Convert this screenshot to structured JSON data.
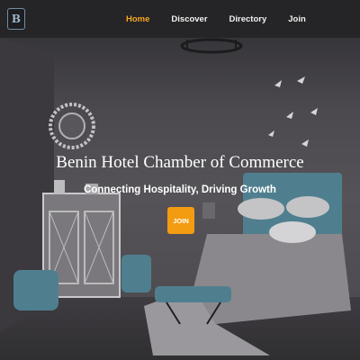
{
  "brand": {
    "logo_letter": "B"
  },
  "nav": {
    "items": [
      {
        "label": "Home",
        "active": true
      },
      {
        "label": "Discover",
        "active": false
      },
      {
        "label": "Directory",
        "active": false
      },
      {
        "label": "Join",
        "active": false
      }
    ]
  },
  "hero": {
    "title": "Benin Hotel Chamber of Commerce",
    "subtitle": "Connecting Hospitality, Driving Growth",
    "cta_label": "JOIN"
  },
  "colors": {
    "accent": "#f39c12",
    "nav_bg": "#252426",
    "active_nav": "#f5a623"
  }
}
